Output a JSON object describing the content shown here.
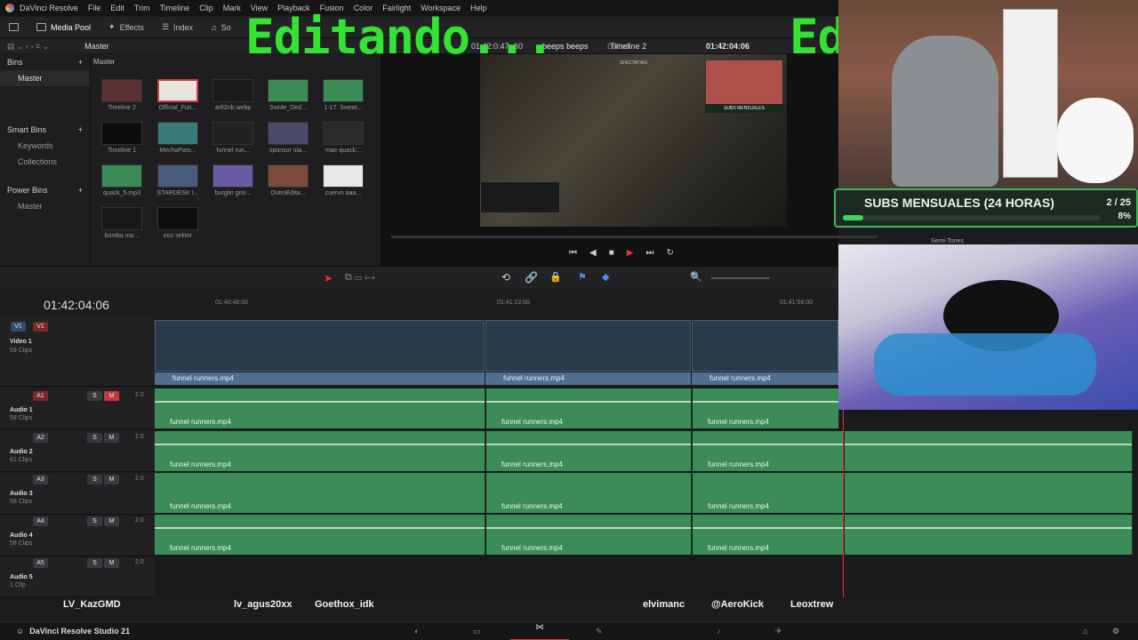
{
  "menubar": {
    "app": "DaVinci Resolve",
    "items": [
      "File",
      "Edit",
      "Trim",
      "Timeline",
      "Clip",
      "Mark",
      "View",
      "Playback",
      "Fusion",
      "Color",
      "Fairlight",
      "Workspace",
      "Help"
    ]
  },
  "toolbar": {
    "media_pool": "Media Pool",
    "effects": "Effects",
    "index": "Index",
    "sound": "So"
  },
  "bin_header": {
    "path": "Master"
  },
  "bins": {
    "title": "Bins",
    "master": "Master",
    "smart_bins": "Smart Bins",
    "keywords": "Keywords",
    "collections": "Collections",
    "power_bins": "Power Bins",
    "power_master": "Master"
  },
  "media_header": "Master",
  "clips": [
    {
      "name": "Timeline 2"
    },
    {
      "name": "Official_Fun..."
    },
    {
      "name": "ar62nb.webp"
    },
    {
      "name": "Swole_Ded..."
    },
    {
      "name": "1-17. Sweet..."
    },
    {
      "name": "Timeline 1"
    },
    {
      "name": "MechaPato..."
    },
    {
      "name": "funnel run..."
    },
    {
      "name": "sponsor sta..."
    },
    {
      "name": "mac-quack..."
    },
    {
      "name": "quack_5.mp3"
    },
    {
      "name": "STARDESK I..."
    },
    {
      "name": "burglin gno..."
    },
    {
      "name": "OutroEdita..."
    },
    {
      "name": "cuervo aaa..."
    },
    {
      "name": "bomba mo..."
    },
    {
      "name": "eco sektor"
    }
  ],
  "viewer": {
    "tc_left": "01:42:0:47",
    "fps": "60",
    "project": "beeps beeps",
    "status": "Edited",
    "timeline": "Timeline 2",
    "tc_right": "01:42:04:06",
    "overlay_label": "SPECTATING",
    "subs_mini": "SUBS MENSUALES"
  },
  "overlay": {
    "editando": "Editando...",
    "ed": "Ed"
  },
  "subs": {
    "title": "SUBS MENSUALES (24 HORAS)",
    "count": "2 / 25",
    "percent": "8%",
    "progress": 0.08
  },
  "semitones": "Semi-Tones",
  "timeline": {
    "timecode": "01:42:04:06",
    "ruler": [
      "01:40:48:00",
      "01:41:22:00",
      "01:41:56:00"
    ]
  },
  "tracks": {
    "v1": {
      "tag": "V1",
      "tag2": "V1",
      "name": "Video 1",
      "count": "59 Clips"
    },
    "a1": {
      "tag": "A1",
      "name": "Audio 1",
      "count": "58 Clips",
      "level": "2.0"
    },
    "a2": {
      "tag": "A2",
      "name": "Audio 2",
      "count": "61 Clips",
      "level": "2.0"
    },
    "a3": {
      "tag": "A3",
      "name": "Audio 3",
      "count": "58 Clips",
      "level": "2.0"
    },
    "a4": {
      "tag": "A4",
      "name": "Audio 4",
      "count": "58 Clips",
      "level": "2.0"
    },
    "a5": {
      "tag": "A5",
      "name": "Audio 5",
      "count": "1 Clip",
      "level": "2.0"
    },
    "clip_name": "funnel runners.mp4",
    "btn_s": "S",
    "btn_m": "M"
  },
  "viewers_names": [
    "LV_KazGMD",
    "lv_agus20xx",
    "Goethox_idk",
    "elvimanc",
    "@AeroKick",
    "Leoxtrew"
  ],
  "taskbar": {
    "title": "DaVinci Resolve Studio 21"
  },
  "colors": {
    "accent_green": "#33e233",
    "audio_clip": "#3c8c57",
    "video_clip": "#4f6f8f",
    "playhead": "#e33333"
  }
}
